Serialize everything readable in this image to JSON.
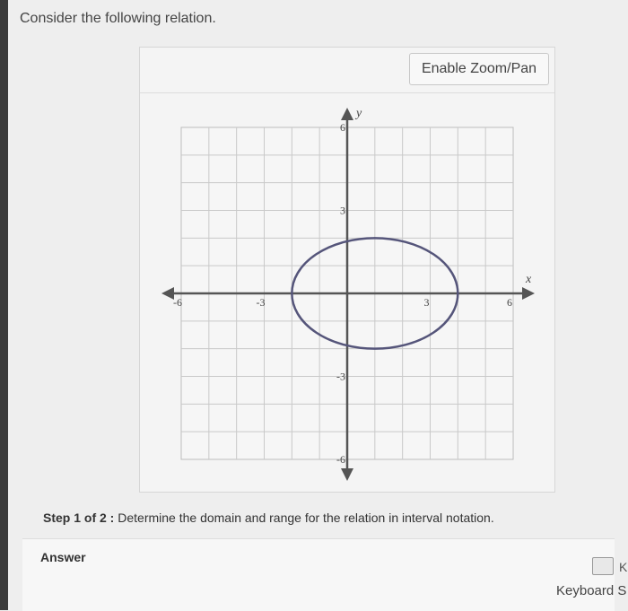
{
  "prompt": "Consider the following relation.",
  "zoom_button": "Enable Zoom/Pan",
  "graph": {
    "axis_x_label": "x",
    "axis_y_label": "y",
    "x_ticks": [
      {
        "value": -6,
        "label": "-6"
      },
      {
        "value": -3,
        "label": "-3"
      },
      {
        "value": 3,
        "label": "3"
      },
      {
        "value": 6,
        "label": "6"
      }
    ],
    "y_ticks": [
      {
        "value": 6,
        "label": "6"
      },
      {
        "value": 3,
        "label": "3"
      },
      {
        "value": -3,
        "label": "-3"
      },
      {
        "value": -6,
        "label": "-6"
      }
    ],
    "xlim": [
      -6,
      6
    ],
    "ylim": [
      -6,
      6
    ],
    "grid": true,
    "ellipse": {
      "center": [
        1,
        0
      ],
      "rx": 3,
      "ry": 2
    },
    "curve_color": "#55557a"
  },
  "step": {
    "prefix": "Step 1 of 2 :",
    "text": "Determine the domain and range for the relation in interval notation."
  },
  "answer_label": "Answer",
  "keyboard": {
    "short": "K",
    "label": "Keyboard S"
  }
}
